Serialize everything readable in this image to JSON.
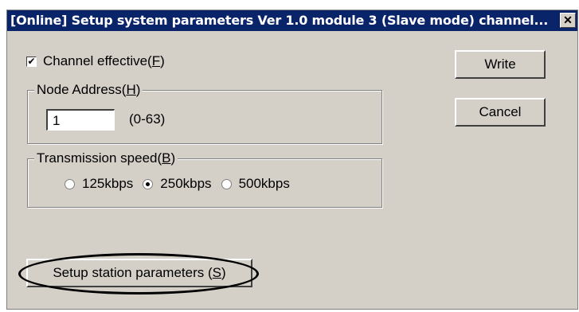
{
  "window": {
    "title": "[Online] Setup system parameters Ver 1.0 module 3 (Slave mode) channel...",
    "close_glyph": "✕"
  },
  "channel_effective": {
    "label": "Channel effective(",
    "mnemonic": "F",
    "label_end": ")",
    "checked": true
  },
  "node_address": {
    "group_label": "Node Address(",
    "mnemonic": "H",
    "label_end": ")",
    "value": "1",
    "range": "(0-63)"
  },
  "transmission_speed": {
    "group_label": "Transmission speed(",
    "mnemonic": "B",
    "label_end": ")",
    "options": [
      {
        "label": "125kbps",
        "selected": false
      },
      {
        "label": "250kbps",
        "selected": true
      },
      {
        "label": "500kbps",
        "selected": false
      }
    ]
  },
  "buttons": {
    "write": "Write",
    "cancel": "Cancel",
    "setup_station": "Setup station parameters (",
    "setup_station_mnemonic": "S",
    "setup_station_end": ")"
  },
  "icons": {
    "checkbox_check": "check-icon",
    "close": "close-icon"
  }
}
